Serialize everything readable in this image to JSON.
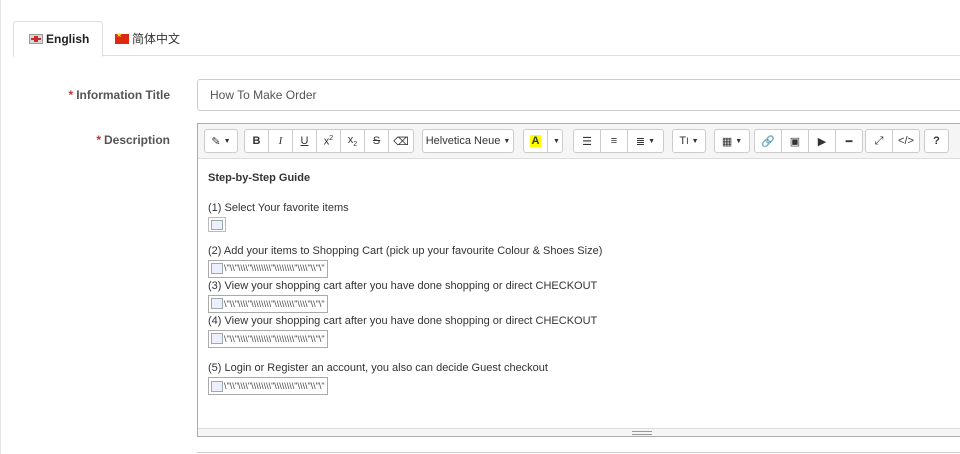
{
  "tabs": [
    {
      "label": "English",
      "flag": "uk-flag-icon",
      "active": true
    },
    {
      "label": "简体中文",
      "flag": "china-flag-icon",
      "active": false
    }
  ],
  "form": {
    "required_mark": "*",
    "title_label": "Information Title",
    "title_value": "How To Make Order",
    "description_label": "Description"
  },
  "toolbar": {
    "font_name": "Helvetica Neue",
    "highlight_letter": "A",
    "text_size_label": "T",
    "help_label": "?"
  },
  "content": {
    "heading": "Step-by-Step Guide",
    "steps": [
      "(1) Select Your favorite items",
      "(2) Add your items to Shopping Cart (pick up your favourite Colour & Shoes Size)",
      "(3) View your shopping cart after you have done shopping or direct CHECKOUT",
      "(4) View your shopping cart after you have done shopping or direct CHECKOUT",
      "(5) Login or Register an account, you also can decide Guest checkout"
    ],
    "broken_alt": "\\\"\\\\\"\\\\\\\\\"\\\\\\\\\\\\\\\\\"\\\\\\\\\\\\\\\\\"\\\\\\\\\"\\\\\"\\\""
  },
  "colors": {
    "required": "#c9302c",
    "highlight": "#ffff00"
  }
}
